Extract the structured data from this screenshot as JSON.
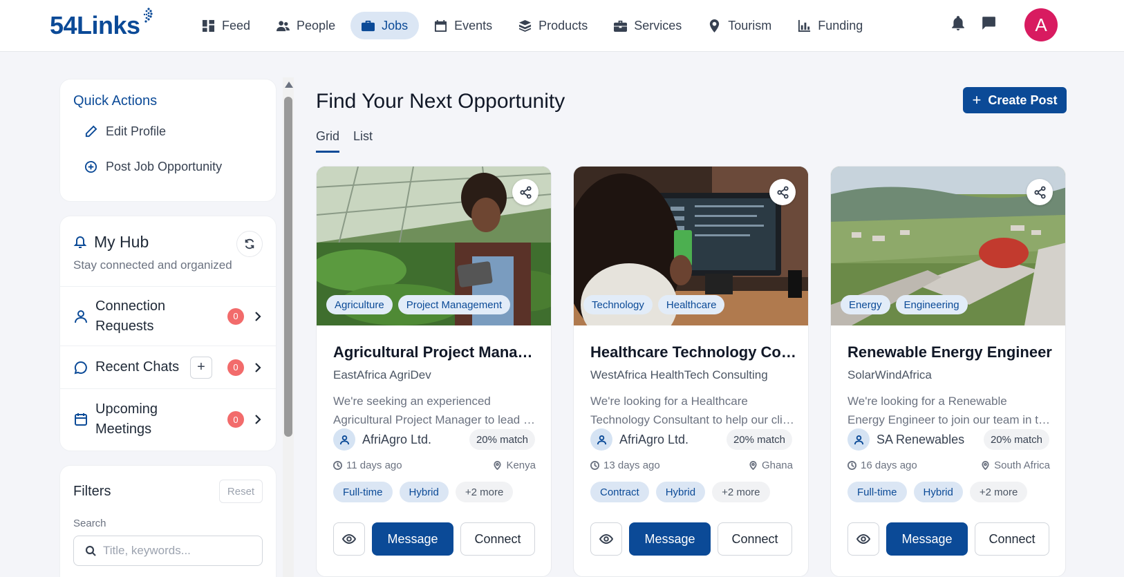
{
  "brand": {
    "logo_text": "54Links"
  },
  "nav": {
    "items": [
      {
        "label": "Feed",
        "icon": "grid-icon"
      },
      {
        "label": "People",
        "icon": "people-icon"
      },
      {
        "label": "Jobs",
        "icon": "briefcase-icon",
        "active": true
      },
      {
        "label": "Events",
        "icon": "calendar-icon"
      },
      {
        "label": "Products",
        "icon": "box-icon"
      },
      {
        "label": "Services",
        "icon": "toolbox-icon"
      },
      {
        "label": "Tourism",
        "icon": "map-pin-icon"
      },
      {
        "label": "Funding",
        "icon": "bar-chart-icon"
      }
    ],
    "avatar_letter": "A"
  },
  "quick_actions": {
    "title": "Quick Actions",
    "items": [
      "Edit Profile",
      "Post Job Opportunity"
    ]
  },
  "hub": {
    "title": "My Hub",
    "subtitle": "Stay connected and organized",
    "rows": [
      {
        "line1": "Connection",
        "line2": "Requests",
        "count": "0"
      },
      {
        "line1": "Recent Chats",
        "count": "0"
      },
      {
        "line1": "Upcoming",
        "line2": "Meetings",
        "count": "0"
      }
    ]
  },
  "filters": {
    "title": "Filters",
    "reset": "Reset",
    "search_label": "Search",
    "search_placeholder": "Title, keywords..."
  },
  "main": {
    "title": "Find Your Next Opportunity",
    "create_post": "Create Post",
    "tabs": [
      "Grid",
      "List"
    ]
  },
  "cards": [
    {
      "tags": [
        "Agriculture",
        "Project Management"
      ],
      "title": "Agricultural Project Manager",
      "company": "EastAfrica AgriDev",
      "desc1": "We're seeking an experienced",
      "desc2": "Agricultural Project Manager to lead our team",
      "poster": "AfriAgro Ltd.",
      "match": "20% match",
      "time": "11 days ago",
      "location": "Kenya",
      "chips": [
        "Full-time",
        "Hybrid",
        "+2 more"
      ],
      "message": "Message",
      "connect": "Connect"
    },
    {
      "tags": [
        "Technology",
        "Healthcare"
      ],
      "title": "Healthcare Technology Consultant",
      "company": "WestAfrica HealthTech Consulting",
      "desc1": "We're looking for a Healthcare",
      "desc2": "Technology Consultant to help our clients",
      "poster": "AfriAgro Ltd.",
      "match": "20% match",
      "time": "13 days ago",
      "location": "Ghana",
      "chips": [
        "Contract",
        "Hybrid",
        "+2 more"
      ],
      "message": "Message",
      "connect": "Connect"
    },
    {
      "tags": [
        "Energy",
        "Engineering"
      ],
      "title": "Renewable Energy Engineer",
      "company": "SolarWindAfrica",
      "desc1": "We're looking for a Renewable",
      "desc2": "Energy Engineer to join our team in the region",
      "poster": "SA Renewables",
      "match": "20% match",
      "time": "16 days ago",
      "location": "South Africa",
      "chips": [
        "Full-time",
        "Hybrid",
        "+2 more"
      ],
      "message": "Message",
      "connect": "Connect"
    }
  ]
}
